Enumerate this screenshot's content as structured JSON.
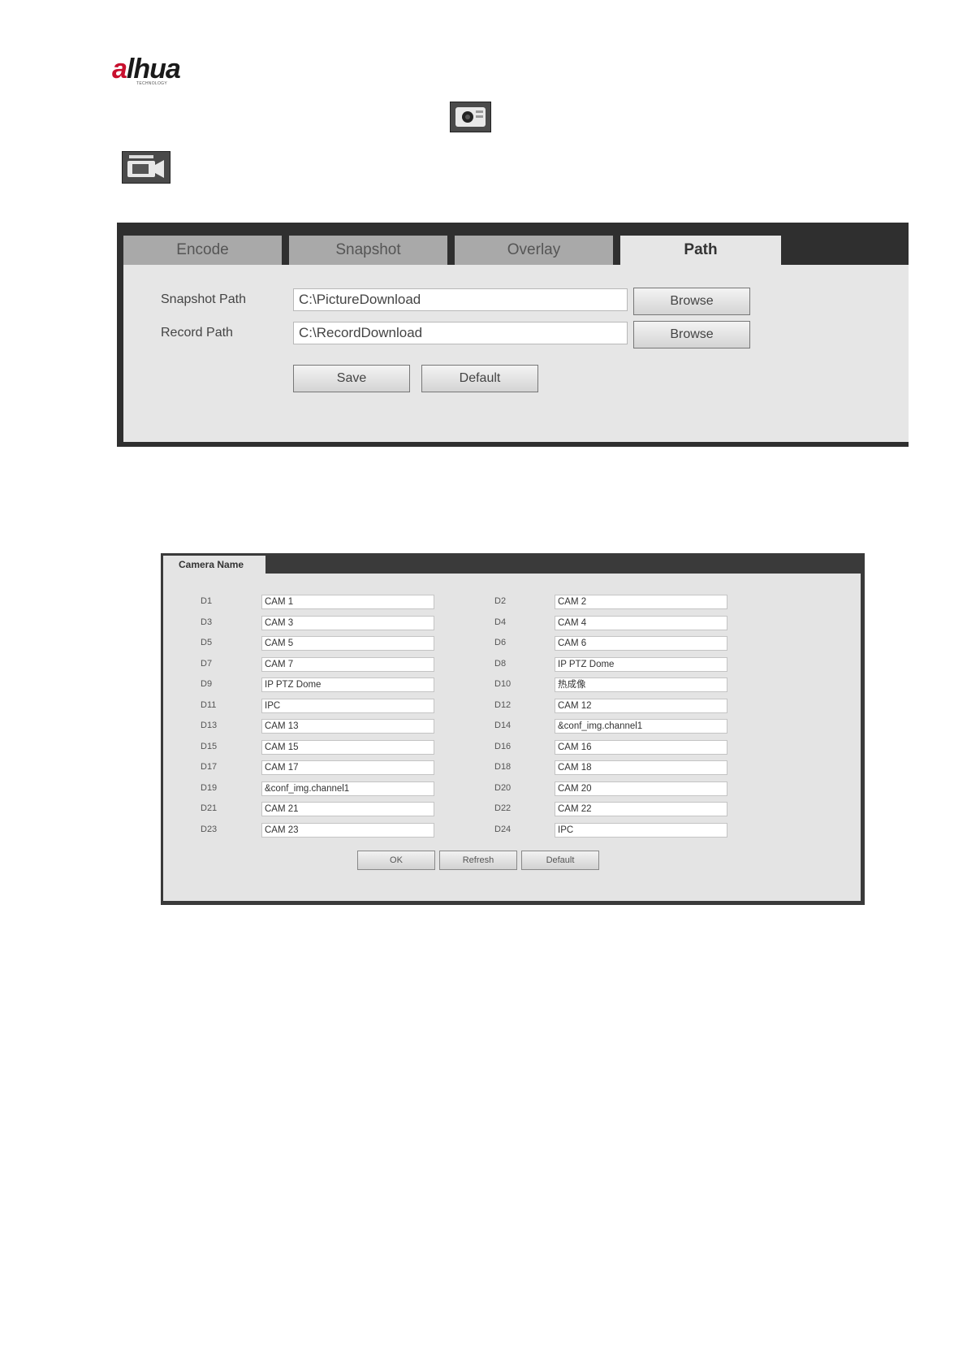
{
  "logo": {
    "brand": "alhua",
    "tagline": "TECHNOLOGY"
  },
  "icons": {
    "snapshot": "snapshot-camera-icon",
    "record": "video-record-icon"
  },
  "panel1": {
    "tabs": [
      "Encode",
      "Snapshot",
      "Overlay",
      "Path"
    ],
    "active_tab": "Path",
    "snapshot_path_label": "Snapshot Path",
    "snapshot_path_value": "C:\\PictureDownload",
    "record_path_label": "Record Path",
    "record_path_value": "C:\\RecordDownload",
    "browse_label": "Browse",
    "save_label": "Save",
    "default_label": "Default"
  },
  "panel2": {
    "tab": "Camera Name",
    "channels": [
      {
        "id": "D1",
        "name": "CAM 1"
      },
      {
        "id": "D2",
        "name": "CAM 2"
      },
      {
        "id": "D3",
        "name": "CAM 3"
      },
      {
        "id": "D4",
        "name": "CAM 4"
      },
      {
        "id": "D5",
        "name": "CAM 5"
      },
      {
        "id": "D6",
        "name": "CAM 6"
      },
      {
        "id": "D7",
        "name": "CAM 7"
      },
      {
        "id": "D8",
        "name": "IP PTZ Dome"
      },
      {
        "id": "D9",
        "name": "IP PTZ Dome"
      },
      {
        "id": "D10",
        "name": "热成像"
      },
      {
        "id": "D11",
        "name": "IPC"
      },
      {
        "id": "D12",
        "name": "CAM 12"
      },
      {
        "id": "D13",
        "name": "CAM 13"
      },
      {
        "id": "D14",
        "name": "&conf_img.channel1"
      },
      {
        "id": "D15",
        "name": "CAM 15"
      },
      {
        "id": "D16",
        "name": "CAM 16"
      },
      {
        "id": "D17",
        "name": "CAM 17"
      },
      {
        "id": "D18",
        "name": "CAM 18"
      },
      {
        "id": "D19",
        "name": "&conf_img.channel1"
      },
      {
        "id": "D20",
        "name": "CAM 20"
      },
      {
        "id": "D21",
        "name": "CAM 21"
      },
      {
        "id": "D22",
        "name": "CAM 22"
      },
      {
        "id": "D23",
        "name": "CAM 23"
      },
      {
        "id": "D24",
        "name": "IPC"
      }
    ],
    "ok_label": "OK",
    "refresh_label": "Refresh",
    "default_label": "Default"
  }
}
